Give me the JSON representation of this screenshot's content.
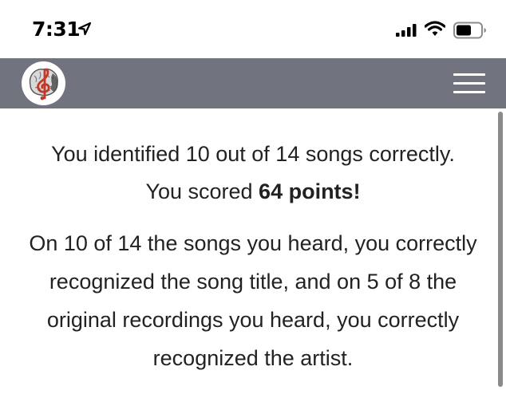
{
  "status_bar": {
    "time": "7:31",
    "icons": [
      "location-arrow-icon",
      "cellular-signal-icon",
      "wifi-icon",
      "battery-icon"
    ]
  },
  "navbar": {
    "logo": "brain-treble-clef-logo",
    "menu_icon": "hamburger-menu-icon",
    "background_color": "#71747f"
  },
  "result": {
    "line1_prefix": "You identified 10 out of 14 songs correctly. You scored ",
    "score_text": "64 points!",
    "detail": "On 10 of 14 the songs you heard, you correctly recognized the song title, and on 5 of 8 the original recordings you heard, you correctly recognized the artist."
  }
}
